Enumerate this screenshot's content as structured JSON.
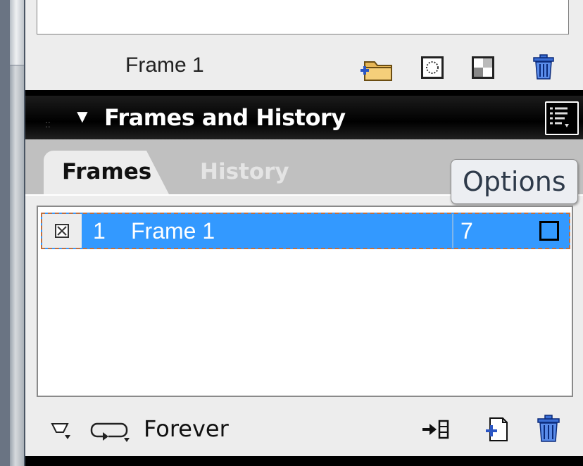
{
  "top": {
    "frame_label": "Frame 1"
  },
  "panel": {
    "title": "Frames and History",
    "tabs": [
      {
        "label": "Frames",
        "active": true
      },
      {
        "label": "History",
        "active": false
      }
    ],
    "options_tooltip": "Options"
  },
  "frames": [
    {
      "number": "1",
      "name": "Frame 1",
      "delay": "7",
      "selected": true
    }
  ],
  "bottom": {
    "loop_label": "Forever"
  },
  "colors": {
    "selection": "#3399ff",
    "header_bg": "#000000",
    "panel_bg": "#ededed"
  },
  "icons": [
    "folder-add-icon",
    "onion-skin-icon",
    "transparency-icon",
    "trash-icon",
    "panel-options-icon",
    "loop-icon",
    "distribute-to-frames-icon",
    "duplicate-frame-icon"
  ]
}
